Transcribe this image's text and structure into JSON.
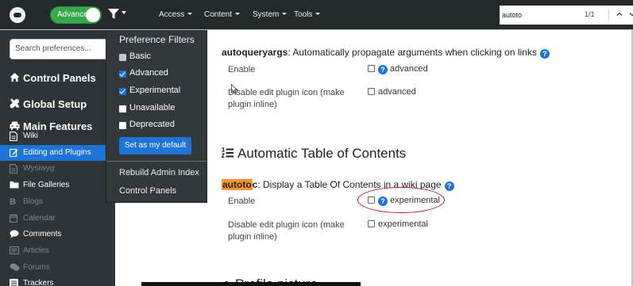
{
  "topnav": {
    "mode_toggle_label": "Advanced",
    "menus": [
      {
        "label": "Access"
      },
      {
        "label": "Content"
      },
      {
        "label": "System"
      },
      {
        "label": "Tools"
      }
    ],
    "find": {
      "value": "autoto",
      "count": "1/1"
    }
  },
  "sidebar": {
    "search_placeholder": "Search preferences...",
    "big_items": [
      {
        "label": "Control Panels",
        "icon": "house-icon"
      },
      {
        "label": "Global Setup",
        "icon": "wrench-icon"
      },
      {
        "label": "Main Features",
        "icon": "car-icon"
      }
    ],
    "items": [
      {
        "label": "Wiki",
        "icon": "file-icon",
        "state": "normal"
      },
      {
        "label": "Editing and Plugins",
        "icon": "edit-icon",
        "state": "active"
      },
      {
        "label": "Wysiwyg",
        "icon": "file-icon",
        "state": "muted"
      },
      {
        "label": "File Galleries",
        "icon": "folder-icon",
        "state": "normal"
      },
      {
        "label": "Blogs",
        "icon": "bold-b-icon",
        "state": "muted"
      },
      {
        "label": "Calendar",
        "icon": "calendar-icon",
        "state": "muted"
      },
      {
        "label": "Comments",
        "icon": "comment-icon",
        "state": "normal"
      },
      {
        "label": "Articles",
        "icon": "newspaper-icon",
        "state": "muted"
      },
      {
        "label": "Forums",
        "icon": "comments-icon",
        "state": "muted"
      },
      {
        "label": "Trackers",
        "icon": "list-icon",
        "state": "normal"
      }
    ]
  },
  "preference_filters": {
    "header": "Preference Filters",
    "options": [
      {
        "label": "Basic",
        "checked": false,
        "dim": true
      },
      {
        "label": "Advanced",
        "checked": true,
        "dim": false
      },
      {
        "label": "Experimental",
        "checked": true,
        "dim": false
      },
      {
        "label": "Unavailable",
        "checked": false,
        "dim": false
      },
      {
        "label": "Deprecated",
        "checked": false,
        "dim": false
      }
    ],
    "set_default_label": "Set as my default",
    "links": [
      "Rebuild Admin Index",
      "Control Panels"
    ]
  },
  "main": {
    "autoqueryargs": {
      "name": "autoqueryargs",
      "description": ": Automatically propagate arguments when clicking on links",
      "rows": [
        {
          "label": "Enable",
          "ctrl": "advanced",
          "help": true
        },
        {
          "label": "Disable edit plugin icon (make plugin inline)",
          "ctrl": "advanced",
          "help": false
        }
      ]
    },
    "section_title": "Automatic Table of Contents",
    "autotoc": {
      "name_highlight": "autoto",
      "name_rest": "c",
      "description": ": Display a Table Of Contents in a wiki page",
      "rows": [
        {
          "label": "Enable",
          "ctrl": "experimental",
          "help": true
        },
        {
          "label": "Disable edit plugin icon (make plugin inline)",
          "ctrl": "experimental",
          "help": false
        }
      ]
    },
    "partial_heading": "Profile picture"
  },
  "colors": {
    "nav_bg": "#24292c",
    "sidebar_bg": "#2f3438",
    "accent_blue": "#1e74d6",
    "toggle_green": "#36a74a",
    "find_highlight": "#ff9632",
    "annotation_red": "#b21d36"
  }
}
